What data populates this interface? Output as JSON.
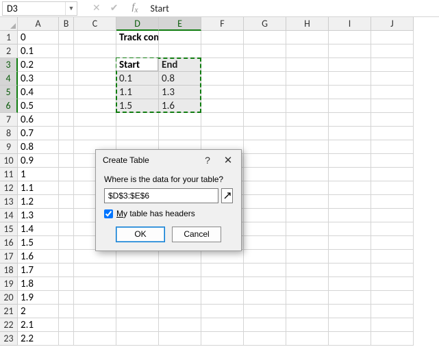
{
  "formula_bar": {
    "name_box": "D3",
    "formula": "Start"
  },
  "columns": [
    "A",
    "B",
    "C",
    "D",
    "E",
    "F",
    "G",
    "H",
    "I",
    "J"
  ],
  "col_widths": {
    "A": 60,
    "B": 22,
    "C": 62,
    "D": 62,
    "E": 62,
    "F": 62,
    "G": 62,
    "H": 62,
    "I": 62,
    "J": 62
  },
  "rows_count": 23,
  "cells": {
    "A1": "0",
    "A2": "0.1",
    "A3": "0.2",
    "A4": "0.3",
    "A5": "0.4",
    "A6": "0.5",
    "A7": "0.6",
    "A8": "0.7",
    "A9": "0.8",
    "A10": "0.9",
    "A11": "1",
    "A12": "1.1",
    "A13": "1.2",
    "A14": "1.3",
    "A15": "1.4",
    "A16": "1.5",
    "A17": "1.6",
    "A18": "1.7",
    "A19": "1.8",
    "A20": "1.9",
    "A21": "2",
    "A22": "2.1",
    "A23": "2.2",
    "D1": "Track completed",
    "D3": "Start",
    "E3": "End",
    "D4": "0.1",
    "E4": "0.8",
    "D5": "1.1",
    "E5": "1.3",
    "D6": "1.5",
    "E6": "1.6"
  },
  "bold_cells": [
    "D1",
    "D3",
    "E3"
  ],
  "selection": {
    "range": "D3:E6",
    "active": "D3",
    "col_sel": [
      "D",
      "E"
    ],
    "row_sel": [
      3,
      4,
      5,
      6
    ]
  },
  "dialog": {
    "title": "Create Table",
    "question": "Where is the data for your table?",
    "range_value": "$D$3:$E$6",
    "checkbox_label": "My table has headers",
    "checkbox_checked": true,
    "ok": "OK",
    "cancel": "Cancel"
  },
  "chart_data": {
    "type": "table",
    "title": "Track completed",
    "columns": [
      "Start",
      "End"
    ],
    "rows": [
      [
        0.1,
        0.8
      ],
      [
        1.1,
        1.3
      ],
      [
        1.5,
        1.6
      ]
    ]
  }
}
